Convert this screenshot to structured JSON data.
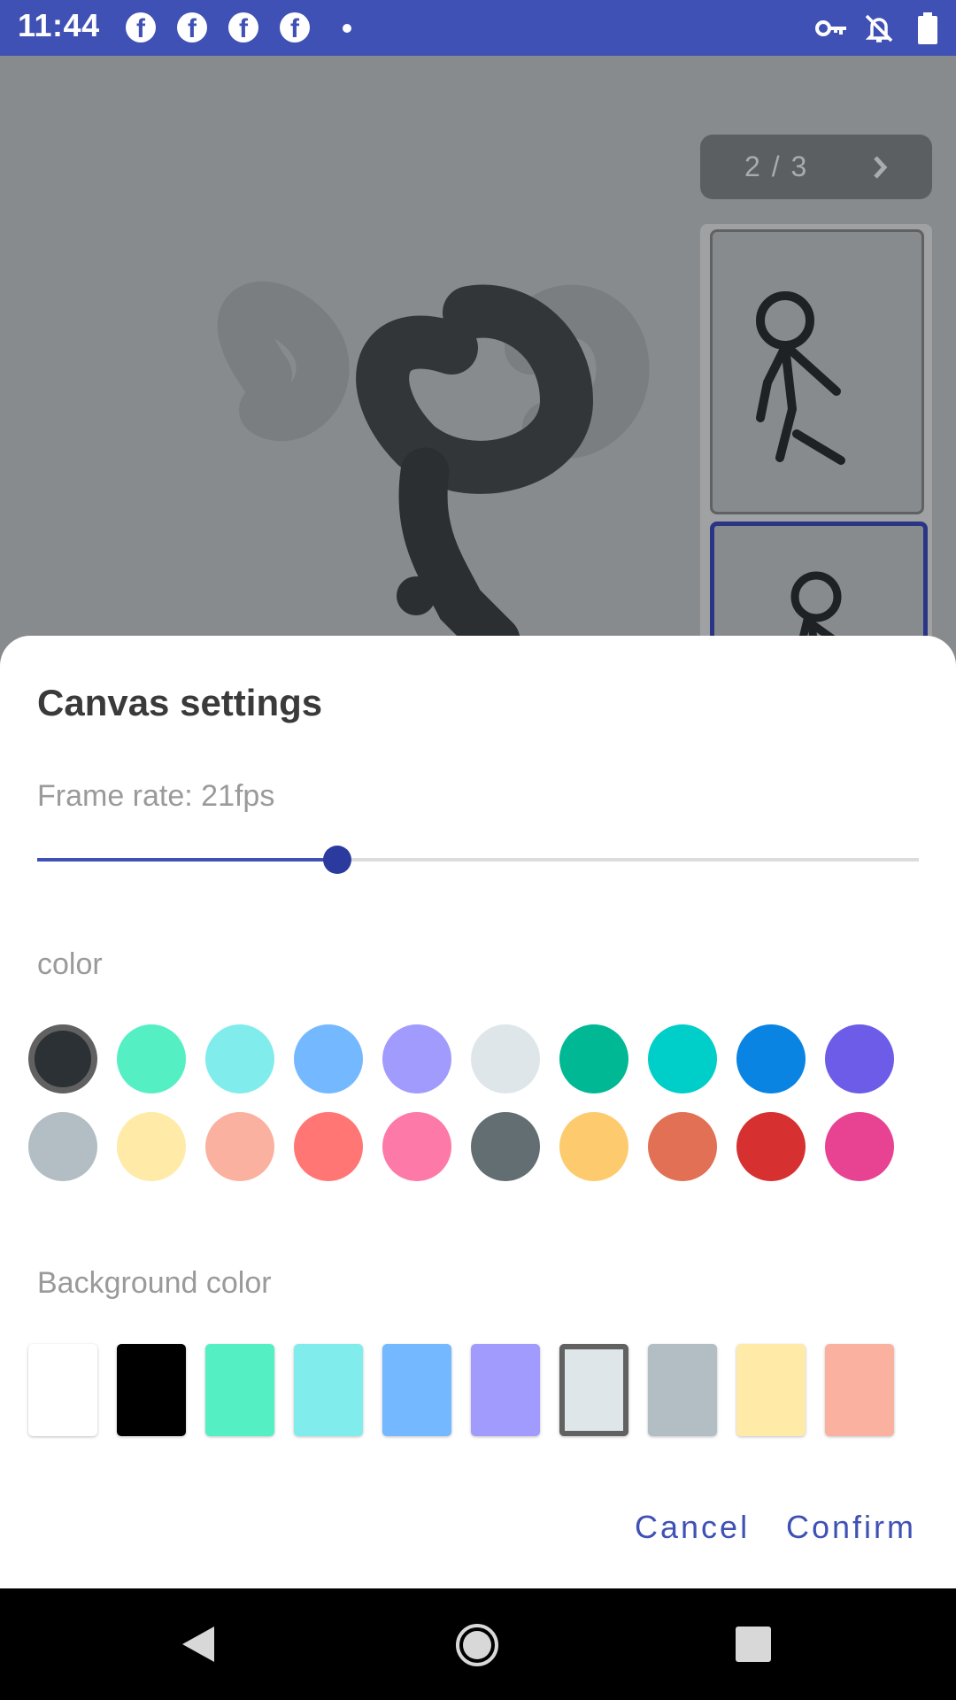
{
  "status_bar": {
    "time": "11:44",
    "notification_icons": [
      "facebook-icon",
      "facebook-icon",
      "facebook-icon",
      "facebook-icon",
      "dot-icon"
    ],
    "right_icons": [
      "vpn-key-icon",
      "notifications-off-icon",
      "battery-icon"
    ]
  },
  "canvas": {
    "frame_counter": "2 / 3",
    "current_frame": 2,
    "total_frames": 3
  },
  "dialog": {
    "title": "Canvas settings",
    "frame_rate": {
      "label": "Frame rate: 21fps",
      "value_fps": 21,
      "slider_fraction": 0.34
    },
    "color": {
      "label": "color",
      "selected_index": 0,
      "swatches": [
        "#2b3134",
        "#55efc4",
        "#81ecec",
        "#74b9ff",
        "#a29bfe",
        "#dfe6e9",
        "#00b894",
        "#00cec9",
        "#0984e3",
        "#6c5ce7",
        "#b2bec3",
        "#ffeaa7",
        "#fab1a0",
        "#ff7675",
        "#fd79a8",
        "#636e72",
        "#fdcb6e",
        "#e17055",
        "#d63031",
        "#e84393"
      ]
    },
    "background_color": {
      "label": "Background color",
      "selected_index": 6,
      "swatches": [
        "#ffffff",
        "#000000",
        "#55efc4",
        "#81ecec",
        "#74b9ff",
        "#a29bfe",
        "#dfe6e9",
        "#b2bec3",
        "#ffeaa7",
        "#fab1a0"
      ]
    },
    "cancel_label": "Cancel",
    "confirm_label": "Confirm"
  },
  "colors": {
    "accent": "#3f51b5",
    "status_bar": "#3f51b5",
    "scrim": "#888b8d"
  },
  "nav_bar": {
    "icons": [
      "back-icon",
      "home-icon",
      "recents-icon"
    ]
  }
}
